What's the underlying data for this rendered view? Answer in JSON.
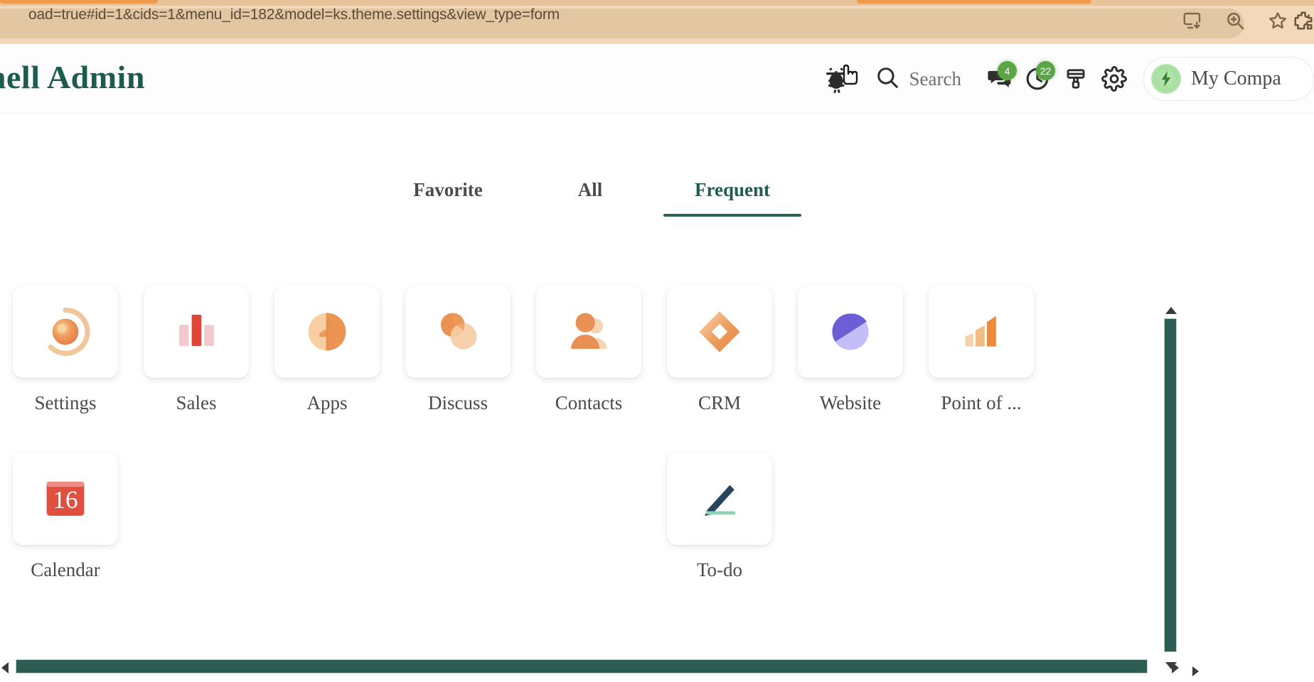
{
  "browser": {
    "url": "oad=true#id=1&cids=1&menu_id=182&model=ks.theme.settings&view_type=form",
    "toolbar_icons": [
      {
        "name": "install-app-icon",
        "glyph": "install"
      },
      {
        "name": "zoom-icon",
        "glyph": "zoom"
      },
      {
        "name": "bookmark-star-icon",
        "glyph": "star"
      },
      {
        "name": "extensions-icon",
        "glyph": "puzzle"
      }
    ]
  },
  "header": {
    "brand_title": "chell Admin",
    "bug_icon_name": "bug-icon",
    "search_label": "Search",
    "messages": {
      "icon": "chat-bubbles-icon",
      "badge": "4"
    },
    "activities": {
      "icon": "clock-icon",
      "badge": "22"
    },
    "theme": {
      "icon": "paint-brush-icon"
    },
    "settings": {
      "icon": "gear-icon"
    },
    "company": {
      "name": "My Compa",
      "avatar_icon": "company-avatar-icon"
    }
  },
  "main": {
    "tabs": [
      {
        "label": "Favorite",
        "active": false
      },
      {
        "label": "All",
        "active": false
      },
      {
        "label": "Frequent",
        "active": true
      }
    ],
    "apps": [
      {
        "label": "Settings",
        "icon": "settings-app-icon"
      },
      {
        "label": "Sales",
        "icon": "sales-app-icon"
      },
      {
        "label": "Apps",
        "icon": "apps-app-icon"
      },
      {
        "label": "Discuss",
        "icon": "discuss-app-icon"
      },
      {
        "label": "Contacts",
        "icon": "contacts-app-icon"
      },
      {
        "label": "CRM",
        "icon": "crm-app-icon"
      },
      {
        "label": "Website",
        "icon": "website-app-icon"
      },
      {
        "label": "Point of ...",
        "icon": "point-of-sale-app-icon"
      },
      {
        "label": "Calendar",
        "icon": "calendar-app-icon",
        "day": "16"
      },
      {
        "label": "To-do",
        "icon": "todo-app-icon"
      }
    ]
  },
  "scrollbars": {
    "vertical_name": "vertical-scrollbar",
    "horizontal_name": "horizontal-scrollbar"
  },
  "colors": {
    "brand_green": "#1e5b4f",
    "scrollbar_green": "#2d5d52",
    "badge_green": "#5aa545",
    "chrome_tan": "#f3d9b9",
    "calendar_red": "#e0503f"
  }
}
